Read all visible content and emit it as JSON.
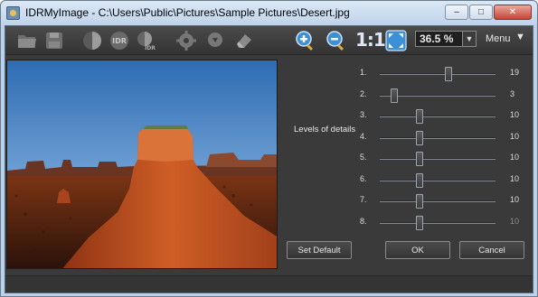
{
  "window": {
    "title": "IDRMyImage - C:\\Users\\Public\\Pictures\\Sample Pictures\\Desert.jpg",
    "controls": {
      "minimize": "–",
      "maximize": "□",
      "close": "✕"
    }
  },
  "toolbar": {
    "icons": [
      "open-folder-icon",
      "save-disk-icon",
      "half-circle-icon",
      "idr-badge-icon",
      "idr-alt-icon",
      "gear-icon",
      "gear-down-icon",
      "eraser-icon",
      "zoom-in-icon",
      "zoom-out-icon",
      "fit-screen-icon"
    ],
    "idr_label": "IDR",
    "one_to_one": "1:1",
    "zoom_value": "36.5 %",
    "zoom_dropdown": "▼",
    "menu_label": "Menu",
    "menu_caret": "▼"
  },
  "settings": {
    "levels_title": "Levels of details",
    "sliders": [
      {
        "index": "1.",
        "value": "19",
        "fraction": 0.6
      },
      {
        "index": "2.",
        "value": "3",
        "fraction": 0.1
      },
      {
        "index": "3.",
        "value": "10",
        "fraction": 0.33
      },
      {
        "index": "4.",
        "value": "10",
        "fraction": 0.33
      },
      {
        "index": "5.",
        "value": "10",
        "fraction": 0.33
      },
      {
        "index": "6.",
        "value": "10",
        "fraction": 0.33
      },
      {
        "index": "7.",
        "value": "10",
        "fraction": 0.33
      },
      {
        "index": "8.",
        "value": "10",
        "fraction": 0.33,
        "dim": true
      }
    ],
    "buttons": {
      "set_default": "Set Default",
      "ok": "OK",
      "cancel": "Cancel"
    }
  },
  "colors": {
    "panel_bg": "#3a3a3a",
    "sky_top": "#2f6fb5",
    "rock": "#b0461c"
  }
}
